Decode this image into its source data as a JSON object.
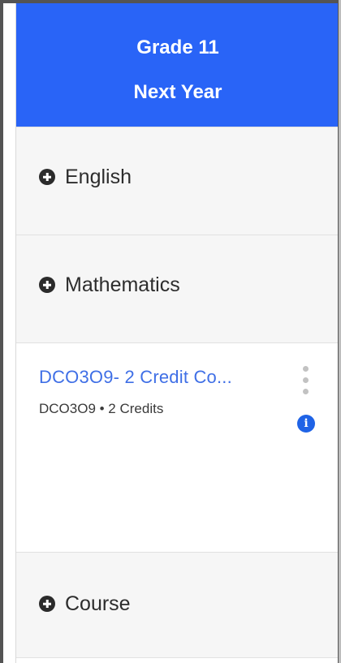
{
  "header": {
    "grade": "Grade 11",
    "year": "Next Year",
    "color": "#2964f7"
  },
  "sections": {
    "english": {
      "label": "English",
      "icon": "plus-circle-icon"
    },
    "mathematics": {
      "label": "Mathematics",
      "icon": "plus-circle-icon"
    },
    "course": {
      "label": "Course",
      "icon": "plus-circle-icon"
    }
  },
  "course_card": {
    "title": "DCO3O9- 2 Credit Co...",
    "subtitle": "DCO3O9 • 2 Credits",
    "info_icon_glyph": "i",
    "title_color": "#3f6fe6"
  }
}
